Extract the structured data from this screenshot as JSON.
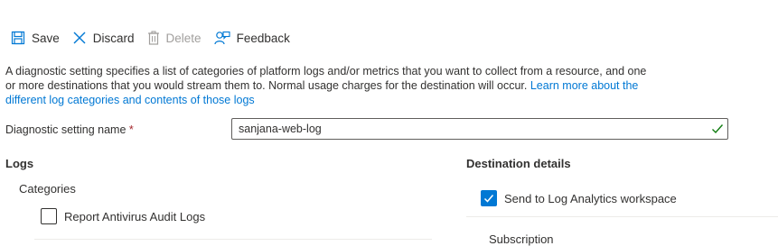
{
  "toolbar": {
    "save_label": "Save",
    "discard_label": "Discard",
    "delete_label": "Delete",
    "feedback_label": "Feedback",
    "icons": [
      "save-icon",
      "close-icon",
      "trash-icon",
      "feedback-icon"
    ]
  },
  "description": {
    "text": "A diagnostic setting specifies a list of categories of platform logs and/or metrics that you want to collect from a resource, and one or more destinations that you would stream them to. Normal usage charges for the destination will occur. ",
    "link_text": "Learn more about the different log categories and contents of those logs"
  },
  "name_field": {
    "label": "Diagnostic setting name",
    "required_marker": "*",
    "value": "sanjana-web-log"
  },
  "logs": {
    "heading": "Logs",
    "categories_label": "Categories",
    "items": [
      {
        "label": "Report Antivirus Audit Logs",
        "checked": false
      }
    ]
  },
  "destination": {
    "heading": "Destination details",
    "send_to_log_analytics_label": "Send to Log Analytics workspace",
    "send_to_log_analytics_checked": true,
    "subscription_label": "Subscription"
  },
  "colors": {
    "accent": "#0078d4",
    "valid": "#107c10",
    "required": "#a4262c"
  }
}
